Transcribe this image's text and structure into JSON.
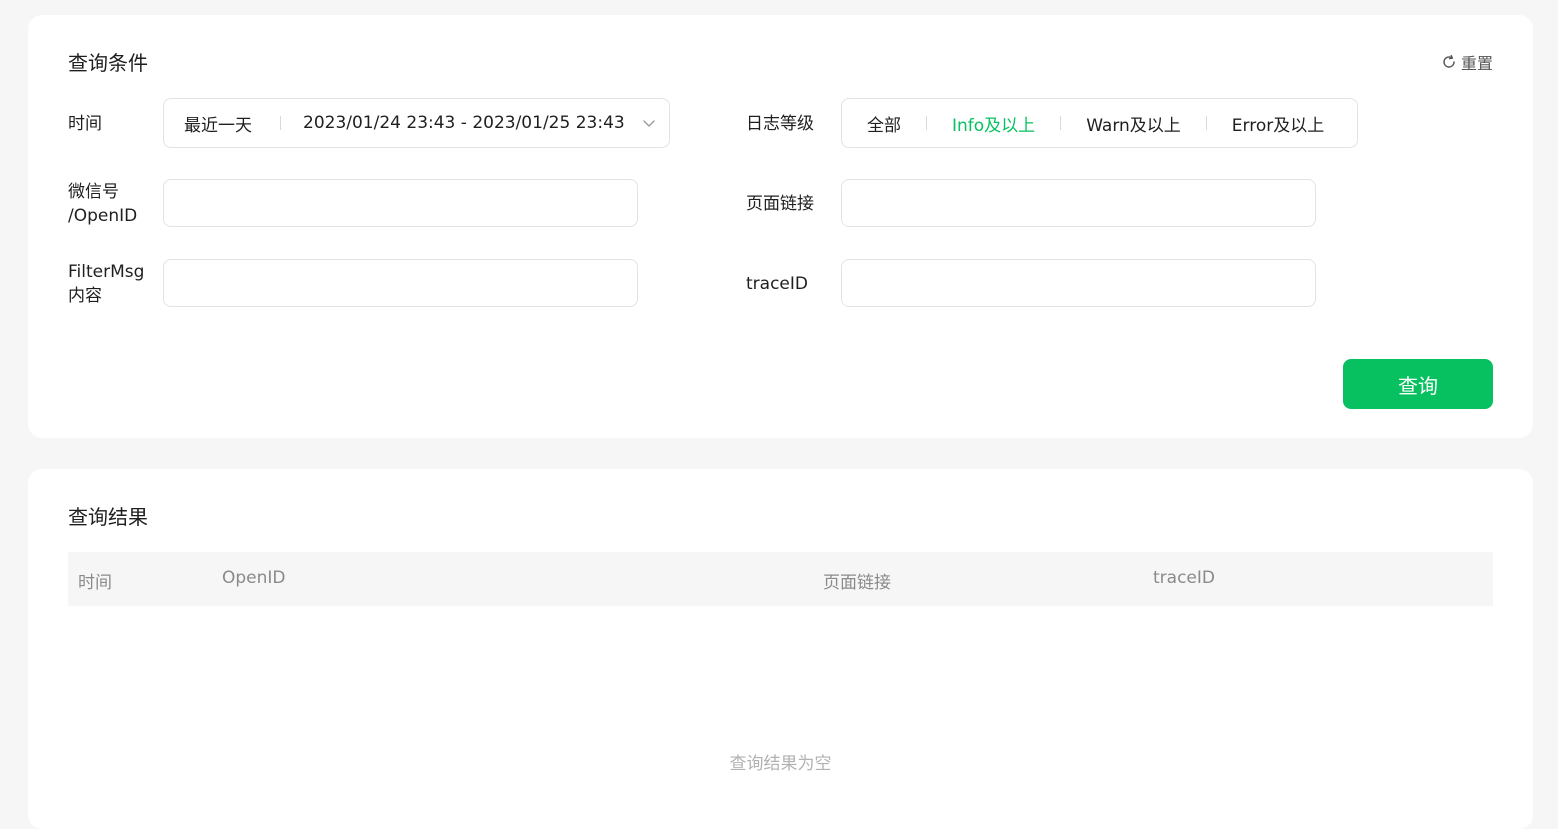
{
  "query_card": {
    "title": "查询条件",
    "reset_label": "重置",
    "time_label": "时间",
    "date_preset": "最近一天",
    "date_range": "2023/01/24 23:43 - 2023/01/25 23:43",
    "level_label": "日志等级",
    "levels": [
      "全部",
      "Info及以上",
      "Warn及以上",
      "Error及以上"
    ],
    "selected_level": "Info及以上",
    "wechat_label_line1": "微信号",
    "wechat_label_line2": "/OpenID",
    "wechat_value": "",
    "page_link_label": "页面链接",
    "page_link_value": "",
    "filter_label_line1": "FilterMsg",
    "filter_label_line2": "内容",
    "filter_value": "",
    "trace_label": "traceID",
    "trace_value": "",
    "query_button": "查询"
  },
  "result_card": {
    "title": "查询结果",
    "columns": [
      "时间",
      "OpenID",
      "页面链接",
      "traceID"
    ],
    "empty_text": "查询结果为空"
  },
  "colors": {
    "accent": "#07c160",
    "background": "#f6f6f6"
  }
}
